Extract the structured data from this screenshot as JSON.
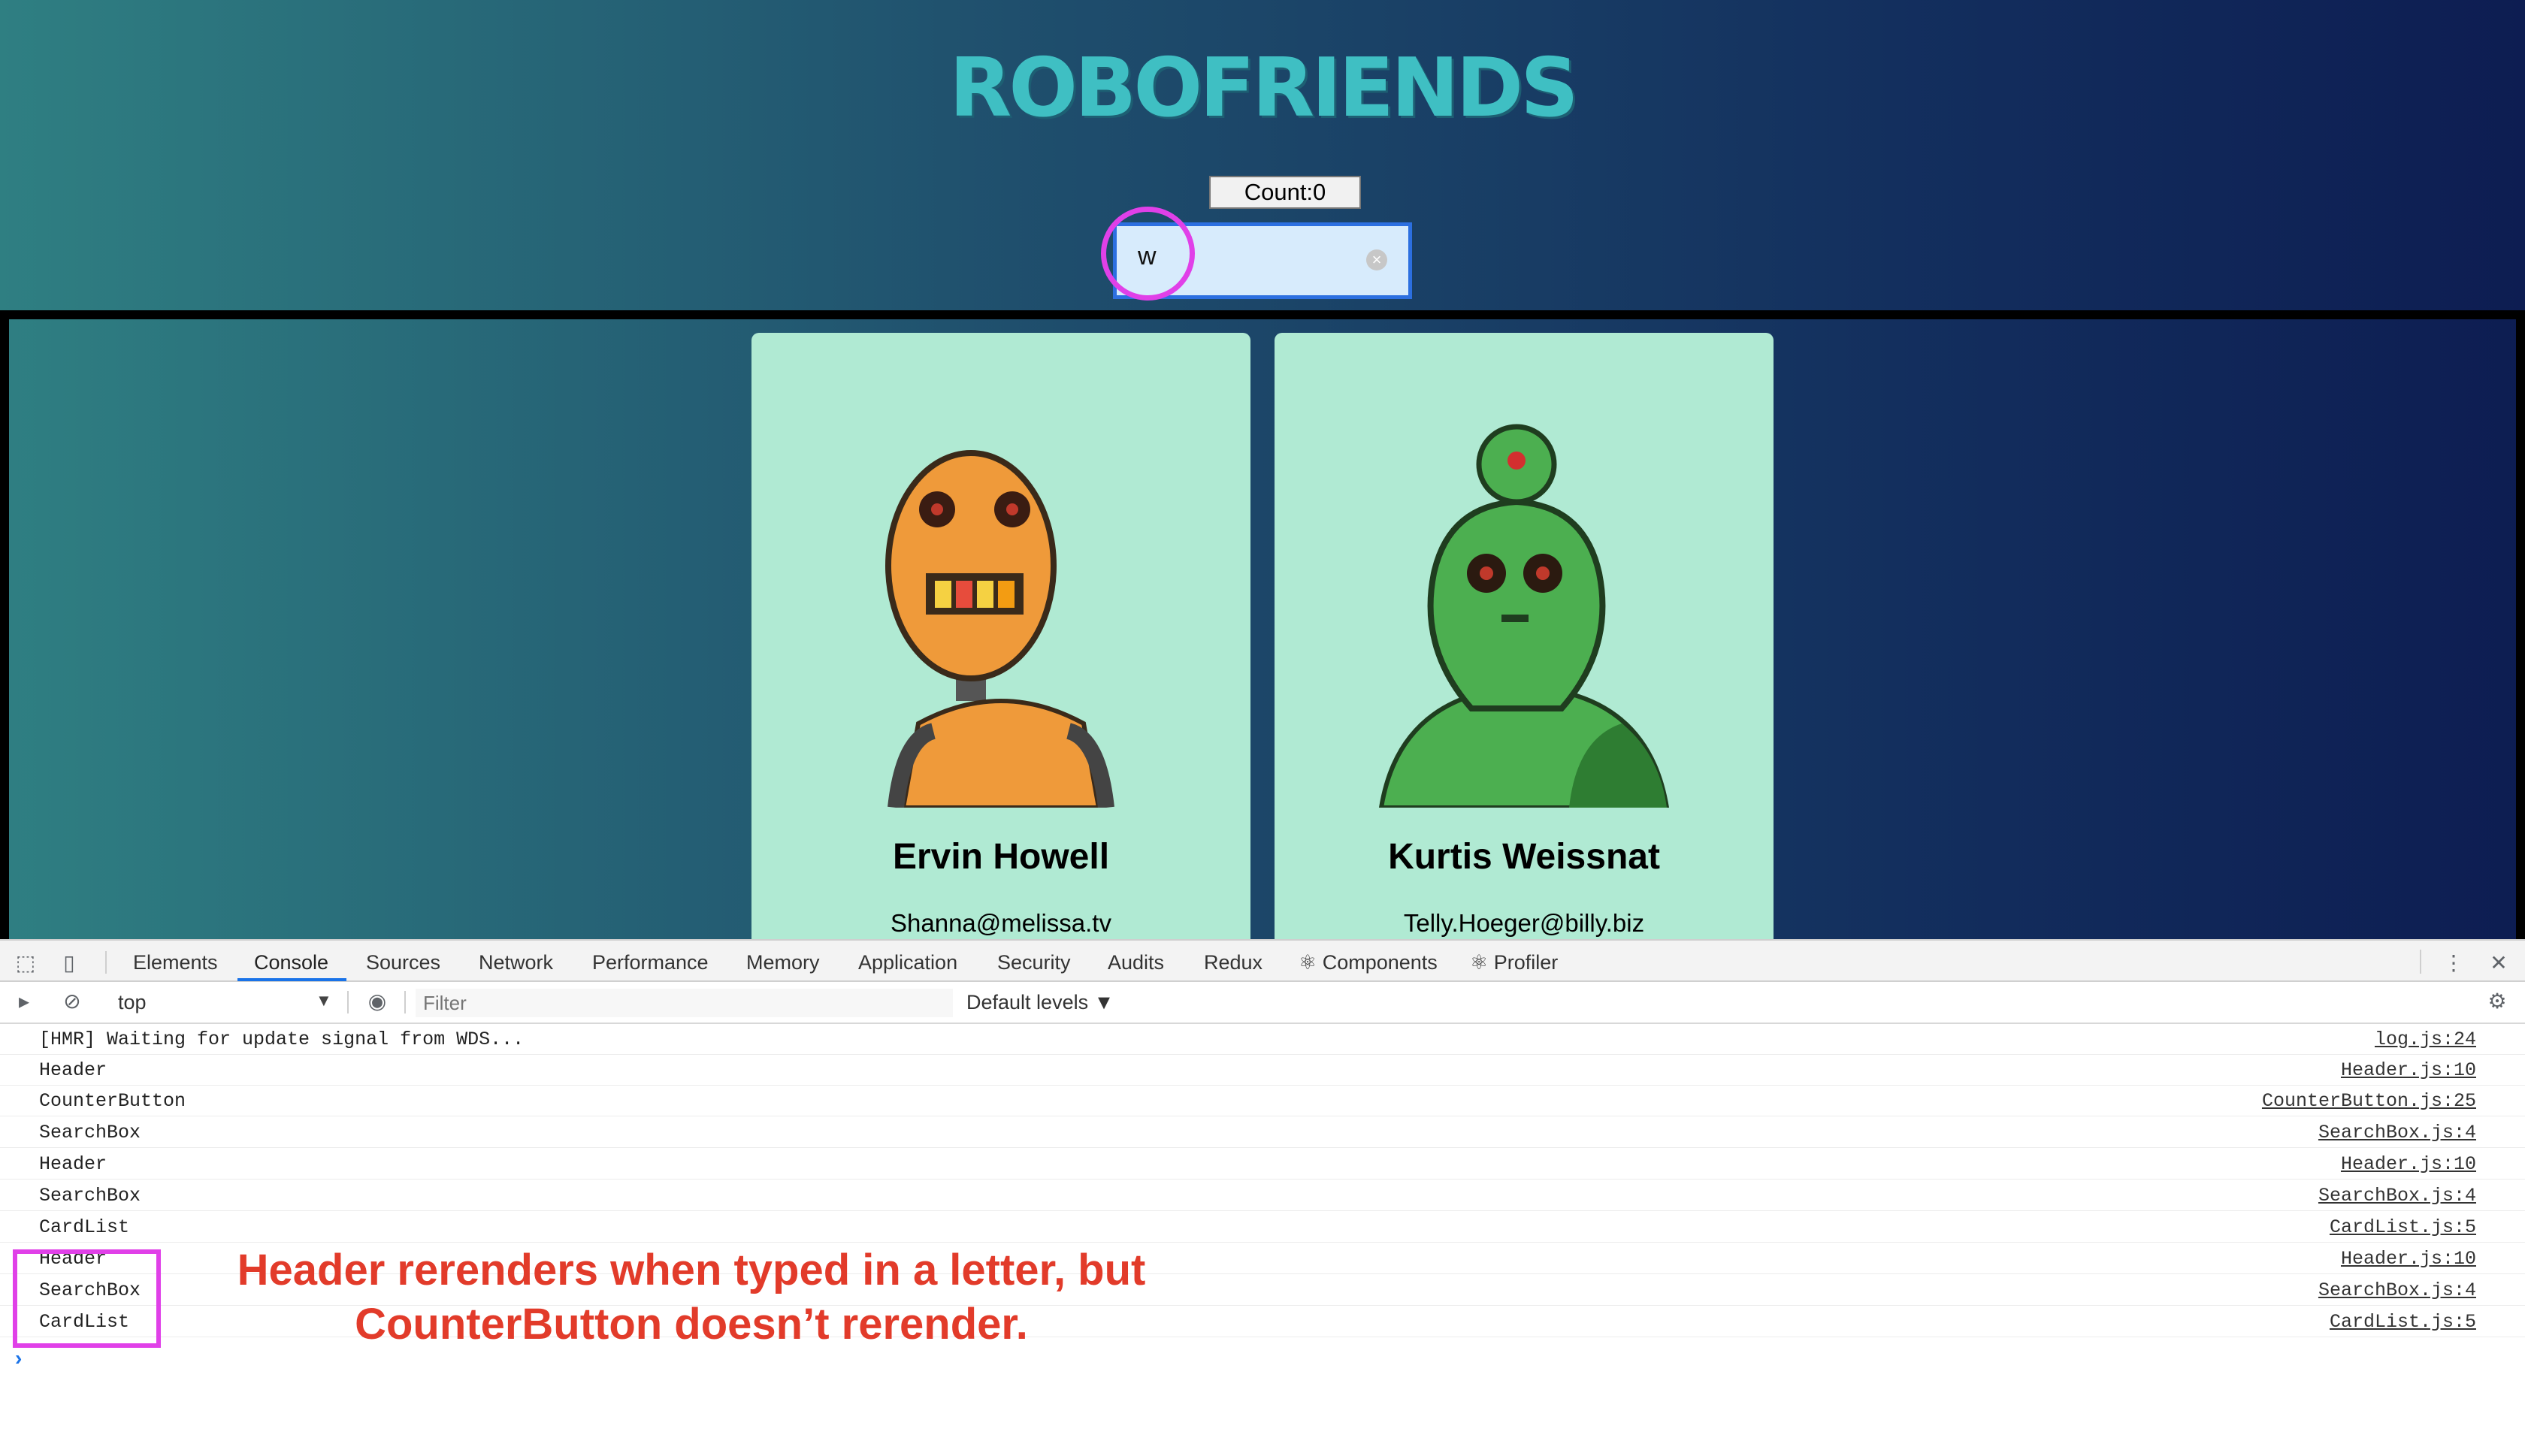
{
  "app": {
    "title": "ROBOFRIENDS",
    "counter_label": "Count:0",
    "search_value": "w",
    "cards": [
      {
        "name": "Ervin Howell",
        "email": "Shanna@melissa.tv",
        "robot_color": "#ef9a3a"
      },
      {
        "name": "Kurtis Weissnat",
        "email": "Telly.Hoeger@billy.biz",
        "robot_color": "#4caf50"
      }
    ]
  },
  "devtools": {
    "tabs": [
      "Elements",
      "Console",
      "Sources",
      "Network",
      "Performance",
      "Memory",
      "Application",
      "Security",
      "Audits",
      "Redux",
      "⚛ Components",
      "⚛ Profiler"
    ],
    "active_tab": "Console",
    "context": "top",
    "filter_placeholder": "Filter",
    "levels": "Default levels ▼",
    "console_rows": [
      {
        "msg": "[HMR] Waiting for update signal from WDS...",
        "src": "log.js:24"
      },
      {
        "msg": "Header",
        "src": "Header.js:10"
      },
      {
        "msg": "CounterButton",
        "src": "CounterButton.js:25"
      },
      {
        "msg": "SearchBox",
        "src": "SearchBox.js:4"
      },
      {
        "msg": "Header",
        "src": "Header.js:10"
      },
      {
        "msg": "SearchBox",
        "src": "SearchBox.js:4"
      },
      {
        "msg": "CardList",
        "src": "CardList.js:5"
      },
      {
        "msg": "Header",
        "src": "Header.js:10"
      },
      {
        "msg": "SearchBox",
        "src": "SearchBox.js:4"
      },
      {
        "msg": "CardList",
        "src": "CardList.js:5"
      }
    ],
    "prompt": "›"
  },
  "annotation": {
    "line1": "Header rerenders when typed in a letter, but",
    "line2": "CounterButton doesn’t rerender."
  },
  "colors": {
    "accent": "#1a73e8",
    "annotation_text": "#e23b2a",
    "highlight": "#e040e8",
    "card_bg": "#b0ead3"
  }
}
